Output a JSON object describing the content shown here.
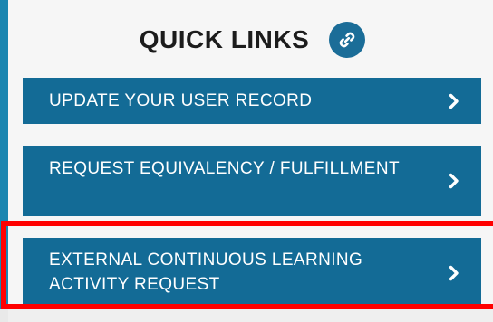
{
  "quick_links": {
    "title": "QUICK LINKS",
    "title_icon": "link-icon",
    "accent_color": "#136b96",
    "highlight_color": "#ff0000",
    "items": [
      {
        "label": "UPDATE YOUR USER RECORD",
        "icon": "chevron-right-icon"
      },
      {
        "label": "REQUEST EQUIVALENCY / FULFILLMENT",
        "icon": "chevron-right-icon"
      },
      {
        "label": "EXTERNAL CONTINUOUS LEARNING ACTIVITY REQUEST",
        "icon": "chevron-right-icon",
        "highlighted": true
      }
    ]
  }
}
